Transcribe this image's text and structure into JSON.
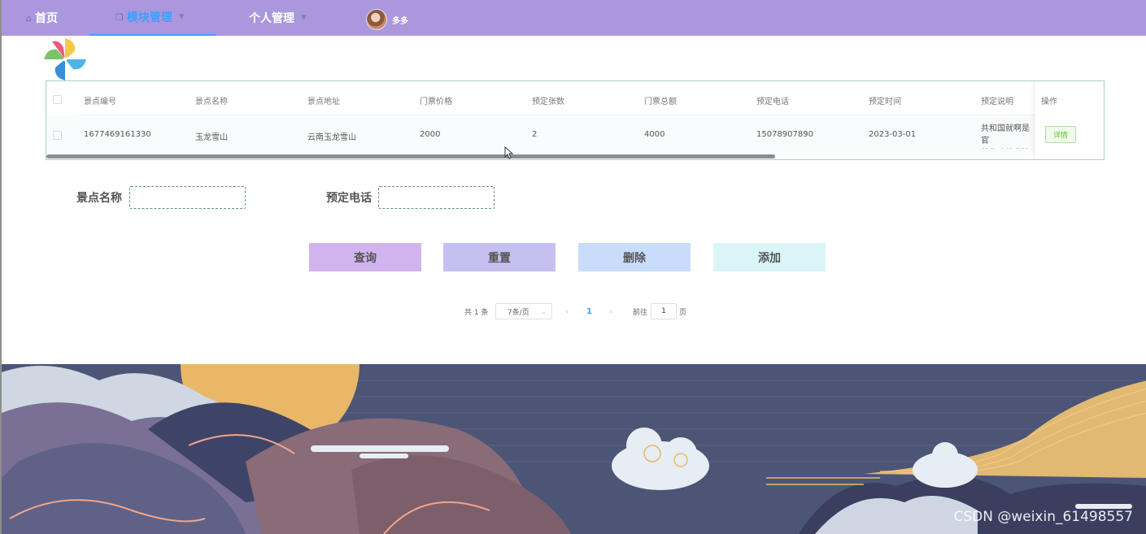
{
  "nav": {
    "home_label": "首页",
    "module_label": "模块管理",
    "personal_label": "个人管理",
    "username": "多多",
    "home_icon": "home-icon",
    "module_icon": "copy-icon",
    "caret_icon": "chevron-down-icon",
    "active_color": "#409eff",
    "bar_color": "#ab98dc"
  },
  "table": {
    "headers": [
      "景点编号",
      "景点名称",
      "景点地址",
      "门票价格",
      "预定张数",
      "门票总额",
      "预定电话",
      "预定时间",
      "预定说明",
      "操作"
    ],
    "rows": [
      {
        "id": "1677469161330",
        "name": "玉龙雪山",
        "address": "云南玉龙雪山",
        "price": "2000",
        "count": "2",
        "total": "4000",
        "phone": "15078907890",
        "time": "2023-03-01",
        "note": "共和国就啊是官\n范化改善方法和",
        "action": "详情"
      }
    ]
  },
  "search": {
    "name_label": "景点名称",
    "name_value": "",
    "phone_label": "预定电话",
    "phone_value": ""
  },
  "buttons": {
    "query": "查询",
    "reset": "重置",
    "delete": "删除",
    "add": "添加",
    "colors": [
      "#d1b3ee",
      "#c6c0f0",
      "#c9dcfb",
      "#daf5f7"
    ]
  },
  "pagination": {
    "total_text": "共 1 条",
    "page_size": "7条/页",
    "current_page": "1",
    "goto_prefix": "前往",
    "goto_value": "1",
    "goto_suffix": "页"
  },
  "watermark": "CSDN @weixin_61498557"
}
